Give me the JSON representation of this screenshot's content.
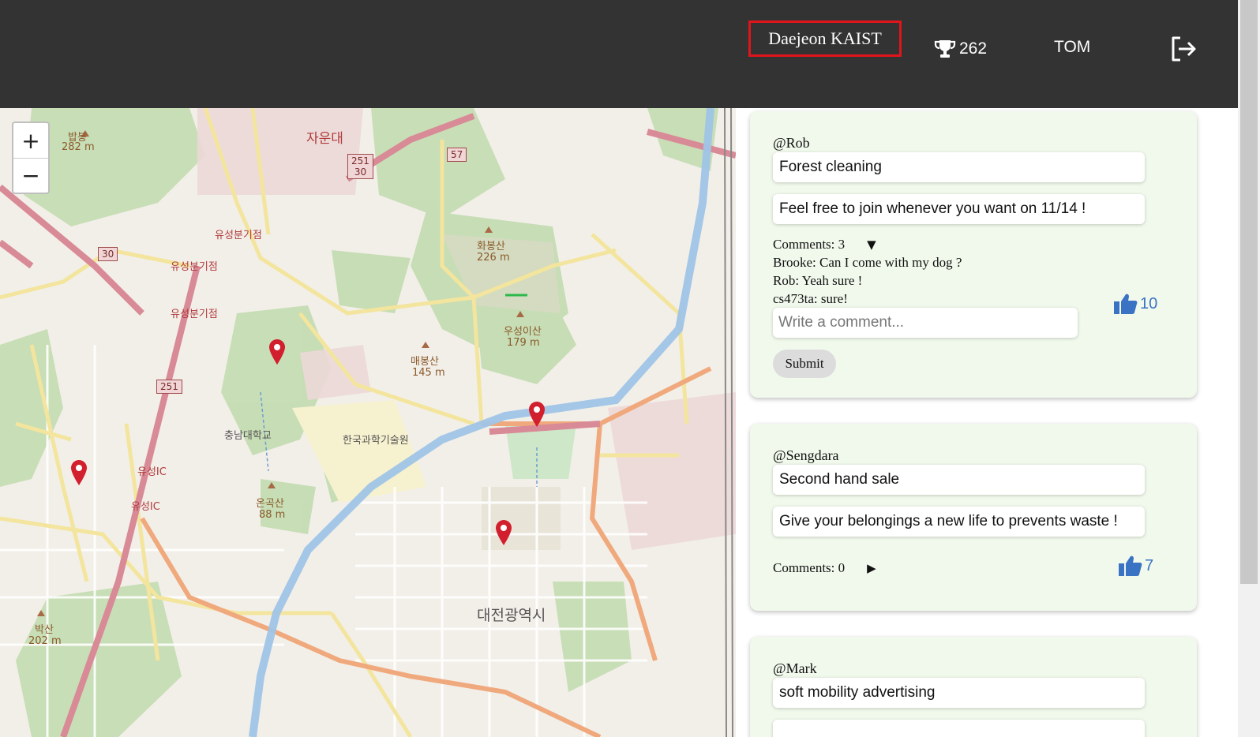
{
  "header": {
    "location": "Daejeon KAIST",
    "score": "262",
    "username": "TOM",
    "trophy_icon": "trophy-icon",
    "logout_icon": "logout-icon"
  },
  "map": {
    "zoom_in": "+",
    "zoom_out": "−",
    "labels": {
      "jaundae": "자운대",
      "bapbong": "밥봉",
      "bapbong_elev": "282 m",
      "hwabongsan": "화봉산",
      "hwabongsan_elev": "226 m",
      "useongisan": "우성이산",
      "useongisan_elev": "179 m",
      "maebongsan": "매봉산",
      "maebongsan_elev": "145 m",
      "chungnam_univ": "충남대학교",
      "kaist": "한국과학기술원",
      "ongongsan": "온곡산",
      "ongongsan_elev": "88 m",
      "daejeon_city": "대전광역시",
      "baksan": "박산",
      "baksan_elev": "202 m",
      "yuseong_jc1": "유성분기점",
      "yuseong_jc2": "유성분기점",
      "yuseong_jc3": "유성분기점",
      "yuseong_ic1": "유성IC",
      "yuseong_ic2": "유성IC"
    },
    "shields": {
      "r251_30": "251\n30",
      "r57": "57",
      "r30": "30",
      "r251": "251"
    },
    "marker_color": "#d21f2e"
  },
  "posts": [
    {
      "author": "@Rob",
      "title": "Forest cleaning",
      "description": "Feel free to join whenever you want on 11/14 !",
      "comments_label": "Comments: 3",
      "toggle": "▼",
      "comments": [
        "Brooke: Can I come with my dog ?",
        "Rob: Yeah sure !",
        "cs473ta: sure!"
      ],
      "comment_placeholder": "Write a comment...",
      "submit_label": "Submit",
      "likes": "10"
    },
    {
      "author": "@Sengdara",
      "title": "Second hand sale",
      "description": "Give your belongings a new life to prevents waste !",
      "comments_label": "Comments: 0",
      "toggle": "▶",
      "likes": "7"
    },
    {
      "author": "@Mark",
      "title": "soft mobility advertising"
    }
  ],
  "colors": {
    "header_bg": "#333333",
    "location_border": "#e0151b",
    "card_bg": "#f1f9ec",
    "like_blue": "#3b73c4"
  }
}
